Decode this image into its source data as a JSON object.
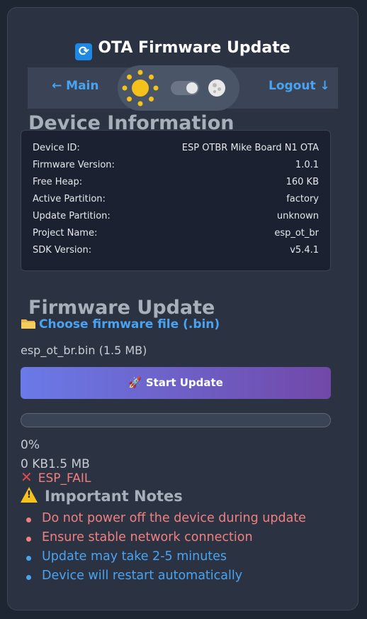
{
  "header": {
    "title": "OTA Firmware Update",
    "title_icon": "refresh-icon"
  },
  "nav": {
    "main_label": "← Main",
    "logout_label": "Logout ↓",
    "theme": {
      "sun_icon": "sun-icon",
      "moon_icon": "moon-icon",
      "mode": "dark"
    }
  },
  "device_info": {
    "heading": "Device Information",
    "rows": [
      {
        "key": "Device ID:",
        "value": "ESP OTBR Mike Board N1 OTA"
      },
      {
        "key": "Firmware Version:",
        "value": "1.0.1"
      },
      {
        "key": "Free Heap:",
        "value": "160 KB"
      },
      {
        "key": "Active Partition:",
        "value": "factory"
      },
      {
        "key": "Update Partition:",
        "value": "unknown"
      },
      {
        "key": "Project Name:",
        "value": "esp_ot_br"
      },
      {
        "key": "SDK Version:",
        "value": "v5.4.1"
      }
    ]
  },
  "firmware_update": {
    "heading": "Firmware Update",
    "choose_icon": "folder-icon",
    "choose_label": "Choose firmware file (.bin)",
    "selected_file": "esp_ot_br.bin (1.5 MB)",
    "start_icon": "rocket-icon",
    "start_label": "Start Update",
    "progress_percent": 0,
    "progress_text": "0%",
    "size_text": "0 KB1.5 MB",
    "error_icon": "x-icon",
    "error_text": "ESP_FAIL"
  },
  "notes": {
    "heading": "Important Notes",
    "warning_icon": "warning-icon",
    "items": [
      {
        "text": "Do not power off the device during update",
        "color": "#f08080"
      },
      {
        "text": "Ensure stable network connection",
        "color": "#f08080"
      },
      {
        "text": "Update may take 2-5 minutes",
        "color": "#4aa3f0"
      },
      {
        "text": "Device will restart automatically",
        "color": "#4aa3f0"
      }
    ]
  },
  "colors": {
    "accent": "#4aa3f0",
    "danger": "#f08080",
    "button_gradient_start": "#6a7ae8",
    "button_gradient_end": "#7148a8"
  }
}
